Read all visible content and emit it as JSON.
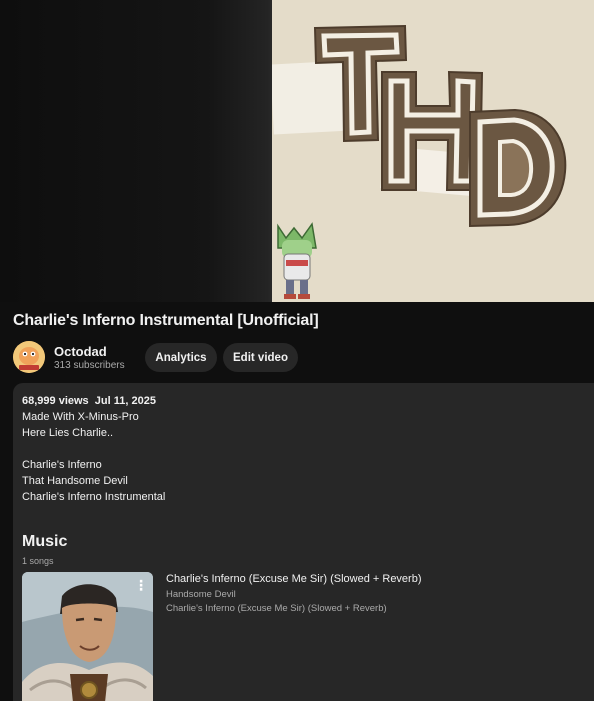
{
  "video": {
    "title": "Charlie's Inferno Instrumental [Unofficial]",
    "thumbnail_text": "THD"
  },
  "channel": {
    "name": "Octodad",
    "subscribers": "313 subscribers",
    "avatar_icon": "octodad-avatar-icon"
  },
  "actions": {
    "analytics_label": "Analytics",
    "edit_label": "Edit video"
  },
  "description": {
    "views": "68,999 views",
    "date": "Jul 11, 2025",
    "lines": [
      "Made With X-Minus-Pro",
      "Here Lies Charlie..",
      "",
      "Charlie's Inferno",
      "That Handsome Devil",
      "Charlie's Inferno Instrumental"
    ]
  },
  "music": {
    "heading": "Music",
    "count": "1 songs",
    "songs": [
      {
        "title": "Charlie's Inferno (Excuse Me Sir) (Slowed + Reverb)",
        "artist": "Handsome Devil",
        "album": "Charlie's Inferno (Excuse Me Sir) (Slowed + Reverb)",
        "menu_icon": "more-vert-icon"
      }
    ]
  },
  "colors": {
    "background": "#0f0f0f",
    "panel": "#272727",
    "text_primary": "#f1f1f1",
    "text_secondary": "#aaaaaa"
  }
}
